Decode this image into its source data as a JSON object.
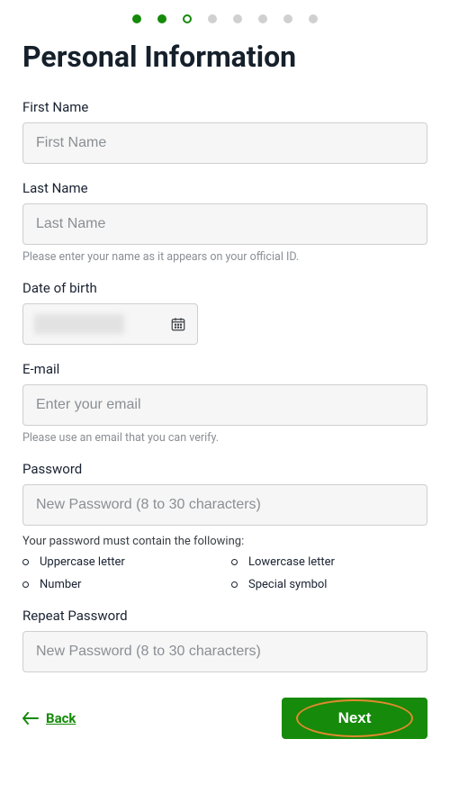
{
  "stepper": {
    "total": 8,
    "completed": 2,
    "current_index": 2
  },
  "heading": "Personal Information",
  "first_name": {
    "label": "First Name",
    "placeholder": "First Name",
    "value": ""
  },
  "last_name": {
    "label": "Last Name",
    "placeholder": "Last Name",
    "value": "",
    "helper": "Please enter your name as it appears on your official ID."
  },
  "dob": {
    "label": "Date of birth"
  },
  "email": {
    "label": "E-mail",
    "placeholder": "Enter your email",
    "value": "",
    "helper": "Please use an email that you can verify."
  },
  "password": {
    "label": "Password",
    "placeholder": "New Password (8 to 30 characters)",
    "value": "",
    "reqs_title": "Your password must contain the following:",
    "reqs": [
      "Uppercase letter",
      "Lowercase letter",
      "Number",
      "Special symbol"
    ]
  },
  "repeat_password": {
    "label": "Repeat Password",
    "placeholder": "New Password (8 to 30 characters)",
    "value": ""
  },
  "nav": {
    "back": "Back",
    "next": "Next"
  }
}
